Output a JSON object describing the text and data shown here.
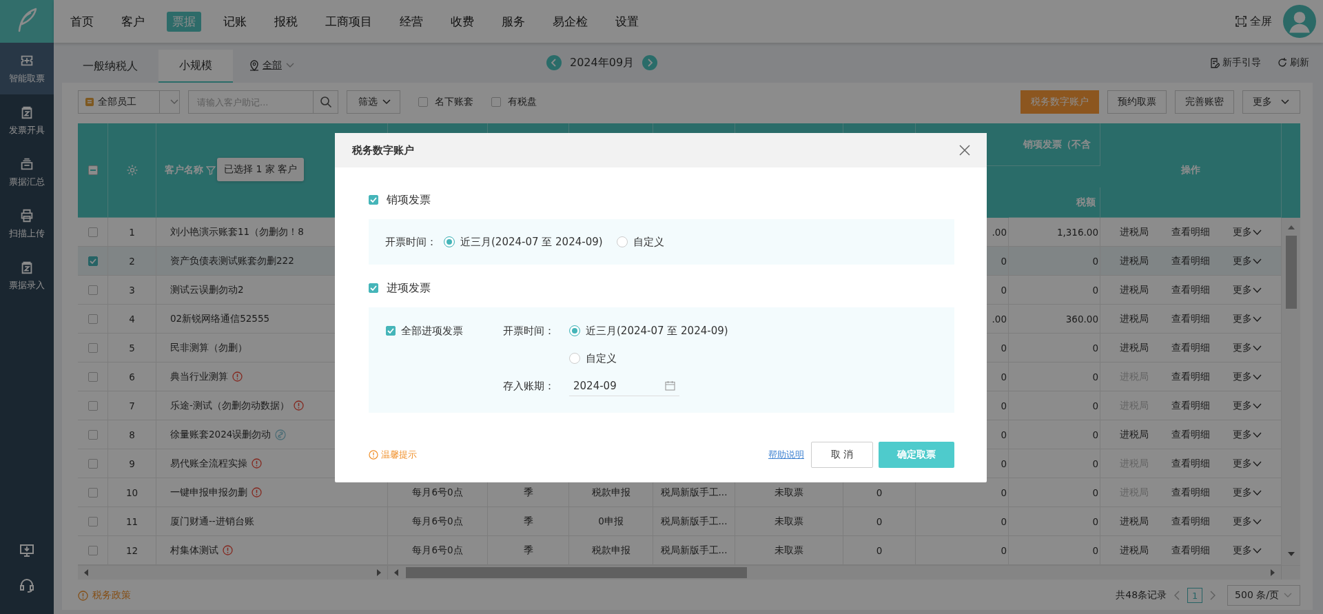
{
  "sidebar": {
    "items": [
      {
        "label": "智能取票",
        "selected": true
      },
      {
        "label": "发票开具",
        "selected": false
      },
      {
        "label": "票据汇总",
        "selected": false
      },
      {
        "label": "扫描上传",
        "selected": false
      },
      {
        "label": "票据录入",
        "selected": false
      }
    ]
  },
  "nav": {
    "items": [
      {
        "label": "首页",
        "selected": false
      },
      {
        "label": "客户",
        "selected": false
      },
      {
        "label": "票据",
        "selected": true
      },
      {
        "label": "记账",
        "selected": false
      },
      {
        "label": "报税",
        "selected": false
      },
      {
        "label": "工商项目",
        "selected": false
      },
      {
        "label": "经营",
        "selected": false
      },
      {
        "label": "收费",
        "selected": false
      },
      {
        "label": "服务",
        "selected": false
      },
      {
        "label": "易企检",
        "selected": false
      },
      {
        "label": "设置",
        "selected": false
      }
    ],
    "fullscreen": "全屏"
  },
  "subbar": {
    "tabs": [
      {
        "label": "一般纳税人",
        "selected": false
      },
      {
        "label": "小规模",
        "selected": true
      }
    ],
    "region": "全部",
    "month": "2024年09月",
    "links": [
      "新手引导",
      "刷新"
    ]
  },
  "toolbar": {
    "staff": "全部员工",
    "search": {
      "placeholder": "请输入客户助记..."
    },
    "filter": "筛选",
    "checks": [
      {
        "label": "名下账套",
        "checked": false
      },
      {
        "label": "有税盘",
        "checked": false
      }
    ],
    "buttons": [
      {
        "label": "税务数字账户",
        "kind": "accent"
      },
      {
        "label": "预约取票",
        "kind": "plain"
      },
      {
        "label": "完善账密",
        "kind": "plain"
      },
      {
        "label": "更多",
        "kind": "menu"
      }
    ]
  },
  "table": {
    "select_all_partial": true,
    "columns": {
      "name": "客户名称",
      "group": "销项发票（不含",
      "tax": "税额",
      "actions": "操作"
    },
    "tooltip": "已选择 1 家 客户",
    "rows": [
      {
        "index": "1",
        "name": "刘小艳演示账套11（勿删勿！8",
        "alert": false,
        "linked": false,
        "checked": false,
        "cells": [],
        "amount": ".00",
        "tax": "1,316.00",
        "actions": [
          {
            "label": "进税局",
            "disabled": false
          },
          {
            "label": "查看明细",
            "disabled": false
          },
          {
            "label": "更多",
            "disabled": false
          }
        ]
      },
      {
        "index": "2",
        "name": "资产负债表测试账套勿删222",
        "alert": false,
        "linked": false,
        "checked": true,
        "cells": [],
        "amount": "0",
        "tax": "0",
        "actions": [
          {
            "label": "进税局",
            "disabled": false
          },
          {
            "label": "查看明细",
            "disabled": false
          },
          {
            "label": "更多",
            "disabled": false
          }
        ]
      },
      {
        "index": "3",
        "name": "测试云误删勿动2",
        "alert": false,
        "linked": false,
        "checked": false,
        "cells": [],
        "amount": "0",
        "tax": "0",
        "actions": [
          {
            "label": "进税局",
            "disabled": false
          },
          {
            "label": "查看明细",
            "disabled": false
          },
          {
            "label": "更多",
            "disabled": false
          }
        ]
      },
      {
        "index": "4",
        "name": "02新锐网络通信52555",
        "alert": false,
        "linked": false,
        "checked": false,
        "cells": [],
        "amount": ".00",
        "tax": "360.00",
        "actions": [
          {
            "label": "进税局",
            "disabled": false
          },
          {
            "label": "查看明细",
            "disabled": false
          },
          {
            "label": "更多",
            "disabled": false
          }
        ]
      },
      {
        "index": "5",
        "name": "民非测算（勿删）",
        "alert": false,
        "linked": false,
        "checked": false,
        "cells": [],
        "amount": "0",
        "tax": "0",
        "actions": [
          {
            "label": "进税局",
            "disabled": false
          },
          {
            "label": "查看明细",
            "disabled": false
          },
          {
            "label": "更多",
            "disabled": false
          }
        ]
      },
      {
        "index": "6",
        "name": "典当行业测算",
        "alert": true,
        "linked": false,
        "checked": false,
        "cells": [],
        "amount": "0",
        "tax": "0",
        "actions": [
          {
            "label": "进税局",
            "disabled": true
          },
          {
            "label": "查看明细",
            "disabled": false
          },
          {
            "label": "更多",
            "disabled": false
          }
        ]
      },
      {
        "index": "7",
        "name": "乐途-测试（勿删勿动数据）",
        "alert": true,
        "linked": false,
        "checked": false,
        "cells": [],
        "amount": "0",
        "tax": "0",
        "actions": [
          {
            "label": "进税局",
            "disabled": true
          },
          {
            "label": "查看明细",
            "disabled": false
          },
          {
            "label": "更多",
            "disabled": false
          }
        ]
      },
      {
        "index": "8",
        "name": "徐量账套2024误删勿动",
        "alert": false,
        "linked": true,
        "checked": false,
        "cells": [],
        "amount": "0",
        "tax": "0",
        "actions": [
          {
            "label": "进税局",
            "disabled": false
          },
          {
            "label": "查看明细",
            "disabled": false
          },
          {
            "label": "更多",
            "disabled": false
          }
        ]
      },
      {
        "index": "9",
        "name": "易代账全流程实操",
        "alert": true,
        "linked": false,
        "checked": false,
        "cells": [],
        "amount": "0",
        "tax": "0",
        "actions": [
          {
            "label": "进税局",
            "disabled": true
          },
          {
            "label": "查看明细",
            "disabled": false
          },
          {
            "label": "更多",
            "disabled": false
          }
        ]
      },
      {
        "index": "10",
        "name": "一键申报申报勿删",
        "alert": true,
        "linked": false,
        "checked": false,
        "cells": [
          "每月6号0点",
          "季",
          "税款申报",
          "税局新版手工...",
          "未取票",
          "0"
        ],
        "amount": "0",
        "tax": "0",
        "actions": [
          {
            "label": "进税局",
            "disabled": true
          },
          {
            "label": "查看明细",
            "disabled": false
          },
          {
            "label": "更多",
            "disabled": false
          }
        ]
      },
      {
        "index": "11",
        "name": "厦门财通--进销台账",
        "alert": false,
        "linked": false,
        "checked": false,
        "cells": [
          "每月6号0点",
          "季",
          "0申报",
          "税局新版手工...",
          "未取票",
          "0"
        ],
        "amount": "0",
        "tax": "0",
        "actions": [
          {
            "label": "进税局",
            "disabled": false
          },
          {
            "label": "查看明细",
            "disabled": false
          },
          {
            "label": "更多",
            "disabled": false
          }
        ]
      },
      {
        "index": "12",
        "name": "村集体测试",
        "alert": true,
        "linked": false,
        "checked": false,
        "cells": [
          "每月6号0点",
          "季",
          "税款申报",
          "税局新版手工...",
          "未取票",
          "0"
        ],
        "amount": "0",
        "tax": "0",
        "actions": [
          {
            "label": "进税局",
            "disabled": false
          },
          {
            "label": "查看明细",
            "disabled": false
          },
          {
            "label": "更多",
            "disabled": false
          }
        ]
      }
    ]
  },
  "footer": {
    "policy": "税务政策",
    "total": "共48条记录",
    "pages": [
      {
        "label": "1",
        "selected": true
      }
    ],
    "page_size": "500 条/页"
  },
  "dialog": {
    "title": "税务数字账户",
    "sections": [
      {
        "kind": "inline",
        "label": "销项发票",
        "checked": true,
        "time_label": "开票时间：",
        "options": [
          {
            "label": "近三月(2024-07 至 2024-09)",
            "selected": true
          },
          {
            "label": "自定义",
            "selected": false
          }
        ]
      },
      {
        "kind": "stacked",
        "label": "进项发票",
        "checked": true,
        "all": {
          "label": "全部进项发票",
          "checked": true
        },
        "time_label": "开票时间：",
        "options": [
          {
            "label": "近三月(2024-07 至 2024-09)",
            "selected": true
          },
          {
            "label": "自定义",
            "selected": false
          }
        ],
        "period": {
          "label": "存入账期：",
          "value": "2024-09"
        }
      }
    ],
    "tip": "温馨提示",
    "help": "帮助说明",
    "cancel": "取 消",
    "confirm": "确定取票"
  }
}
